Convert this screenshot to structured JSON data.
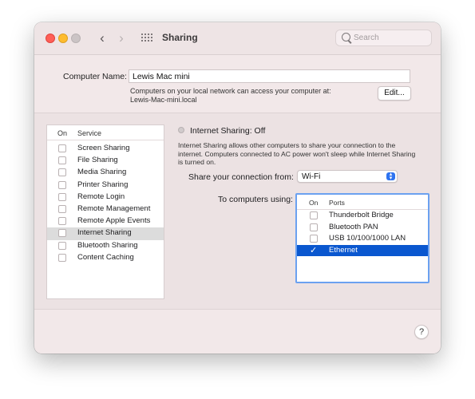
{
  "window": {
    "title": "Sharing"
  },
  "toolbar": {
    "back_icon": "chevron-left-icon",
    "forward_icon": "chevron-right-icon",
    "grid_icon": "show-all-grid-icon",
    "search_placeholder": "Search"
  },
  "computer_name": {
    "label": "Computer Name:",
    "value": "Lewis Mac mini",
    "help_line1": "Computers on your local network can access your computer at:",
    "help_line2": "Lewis-Mac-mini.local",
    "edit_label": "Edit..."
  },
  "services": {
    "header_on": "On",
    "header_service": "Service",
    "items": [
      {
        "label": "Screen Sharing",
        "on": false,
        "selected": false
      },
      {
        "label": "File Sharing",
        "on": false,
        "selected": false
      },
      {
        "label": "Media Sharing",
        "on": false,
        "selected": false
      },
      {
        "label": "Printer Sharing",
        "on": false,
        "selected": false
      },
      {
        "label": "Remote Login",
        "on": false,
        "selected": false
      },
      {
        "label": "Remote Management",
        "on": false,
        "selected": false
      },
      {
        "label": "Remote Apple Events",
        "on": false,
        "selected": false
      },
      {
        "label": "Internet Sharing",
        "on": false,
        "selected": true
      },
      {
        "label": "Bluetooth Sharing",
        "on": false,
        "selected": false
      },
      {
        "label": "Content Caching",
        "on": false,
        "selected": false
      }
    ]
  },
  "detail": {
    "status_title": "Internet Sharing: Off",
    "description": "Internet Sharing allows other computers to share your connection to the internet. Computers connected to AC power won't sleep while Internet Sharing is turned on.",
    "share_from_label": "Share your connection from:",
    "share_from_value": "Wi-Fi",
    "to_computers_label": "To computers using:",
    "ports_header_on": "On",
    "ports_header_ports": "Ports",
    "ports": [
      {
        "label": "Thunderbolt Bridge",
        "on": false,
        "selected": false
      },
      {
        "label": "Bluetooth PAN",
        "on": false,
        "selected": false
      },
      {
        "label": "USB 10/100/1000 LAN",
        "on": false,
        "selected": false
      },
      {
        "label": "Ethernet",
        "on": true,
        "selected": true
      }
    ]
  },
  "help_label": "?",
  "colors": {
    "accent": "#0a57cf",
    "focus_ring": "#6ba1f0",
    "traffic_red": "#ff5f57",
    "traffic_yellow": "#febc2e"
  }
}
